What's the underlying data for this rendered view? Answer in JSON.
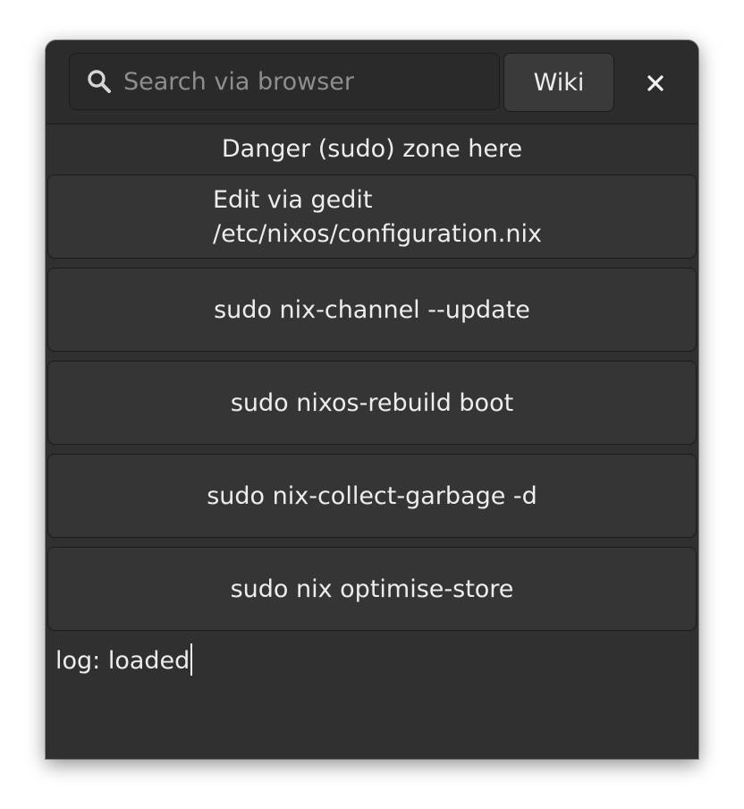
{
  "header": {
    "search": {
      "placeholder": "Search via browser",
      "value": ""
    },
    "wiki_label": "Wiki",
    "close_icon": "close-icon"
  },
  "zone": {
    "title": "Danger (sudo) zone here"
  },
  "actions": [
    {
      "line1": "Edit via gedit",
      "line2": "/etc/nixos/configuration.nix"
    },
    {
      "label": "sudo nix-channel --update"
    },
    {
      "label": "sudo nixos-rebuild boot"
    },
    {
      "label": "sudo nix-collect-garbage -d"
    },
    {
      "label": "sudo nix optimise-store"
    }
  ],
  "log": {
    "text": "log: loaded"
  },
  "colors": {
    "window_bg": "#303030",
    "headerbar_bg": "#2c2c2c",
    "button_bg": "#353535",
    "text": "#ededed",
    "placeholder": "#8e8e8e"
  }
}
